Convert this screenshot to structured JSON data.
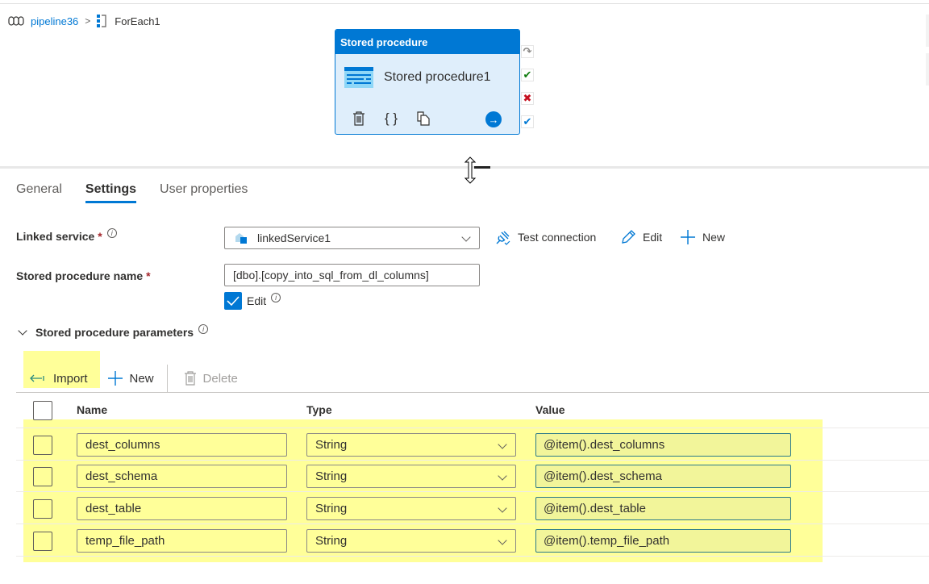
{
  "breadcrumb": {
    "pipeline_icon": "pipeline-icon",
    "pipeline": "pipeline36",
    "separator": ">",
    "foreach_icon": "foreach-icon",
    "current": "ForEach1"
  },
  "activity": {
    "type_label": "Stored procedure",
    "name": "Stored procedure1",
    "icon": "stored-procedure-icon",
    "actions": [
      "delete-icon",
      "code-icon",
      "copy-icon"
    ],
    "go_icon": "arrow-right-circle-icon",
    "ports": [
      {
        "name": "skip-port",
        "glyph": "↷",
        "color": "#8a8886"
      },
      {
        "name": "success-port",
        "glyph": "✔",
        "color": "#107c10"
      },
      {
        "name": "failure-port",
        "glyph": "✖",
        "color": "#c50f1f"
      },
      {
        "name": "completion-port",
        "glyph": "✔",
        "color": "#0078d4"
      }
    ]
  },
  "tabs": [
    {
      "label": "General",
      "active": false
    },
    {
      "label": "Settings",
      "active": true
    },
    {
      "label": "User properties",
      "active": false
    }
  ],
  "settings": {
    "linked_service": {
      "label": "Linked service",
      "required": "*",
      "info": "i",
      "value": "linkedService1",
      "test_connection": "Test connection",
      "edit": "Edit",
      "new": "New"
    },
    "stored_procedure_name": {
      "label": "Stored procedure name",
      "required": "*",
      "value": "[dbo].[copy_into_sql_from_dl_columns]",
      "edit_checkbox_label": "Edit",
      "edit_checked": true,
      "info": "i"
    },
    "parameters_section": {
      "label": "Stored procedure parameters",
      "info": "i",
      "expanded": true
    },
    "toolbar": {
      "import": "Import",
      "new": "New",
      "delete": "Delete"
    },
    "table": {
      "columns": [
        "Name",
        "Type",
        "Value"
      ],
      "rows": [
        {
          "name": "dest_columns",
          "type": "String",
          "value": "@item().dest_columns"
        },
        {
          "name": "dest_schema",
          "type": "String",
          "value": "@item().dest_schema"
        },
        {
          "name": "dest_table",
          "type": "String",
          "value": "@item().dest_table"
        },
        {
          "name": "temp_file_path",
          "type": "String",
          "value": "@item().temp_file_path"
        }
      ]
    }
  },
  "colors": {
    "accent": "#0078d4",
    "highlight": "#ffff99",
    "required": "#a4262c"
  }
}
